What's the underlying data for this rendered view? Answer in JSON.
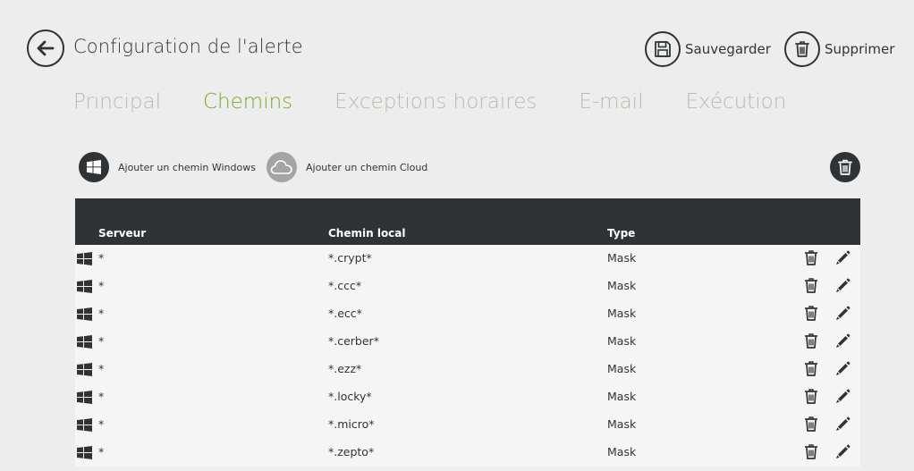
{
  "header": {
    "title": "Configuration de l'alerte",
    "save_label": "Sauvegarder",
    "delete_label": "Supprimer"
  },
  "tabs": [
    {
      "label": "Principal",
      "active": false
    },
    {
      "label": "Chemins",
      "active": true
    },
    {
      "label": "Exceptions horaires",
      "active": false
    },
    {
      "label": "E-mail",
      "active": false
    },
    {
      "label": "Exécution",
      "active": false
    }
  ],
  "toolbar": {
    "add_windows_label": "Ajouter un chemin Windows",
    "add_cloud_label": "Ajouter un chemin Cloud"
  },
  "table": {
    "columns": {
      "server": "Serveur",
      "path": "Chemin local",
      "type": "Type"
    },
    "rows": [
      {
        "server": "*",
        "path": "*.crypt*",
        "type": "Mask"
      },
      {
        "server": "*",
        "path": "*.ccc*",
        "type": "Mask"
      },
      {
        "server": "*",
        "path": "*.ecc*",
        "type": "Mask"
      },
      {
        "server": "*",
        "path": "*.cerber*",
        "type": "Mask"
      },
      {
        "server": "*",
        "path": "*.ezz*",
        "type": "Mask"
      },
      {
        "server": "*",
        "path": "*.locky*",
        "type": "Mask"
      },
      {
        "server": "*",
        "path": "*.micro*",
        "type": "Mask"
      },
      {
        "server": "*",
        "path": "*.zepto*",
        "type": "Mask"
      }
    ]
  },
  "colors": {
    "accent": "#7aaa2a",
    "dark": "#2f3335",
    "tab_inactive": "#b7bcac",
    "background": "#ededed"
  }
}
